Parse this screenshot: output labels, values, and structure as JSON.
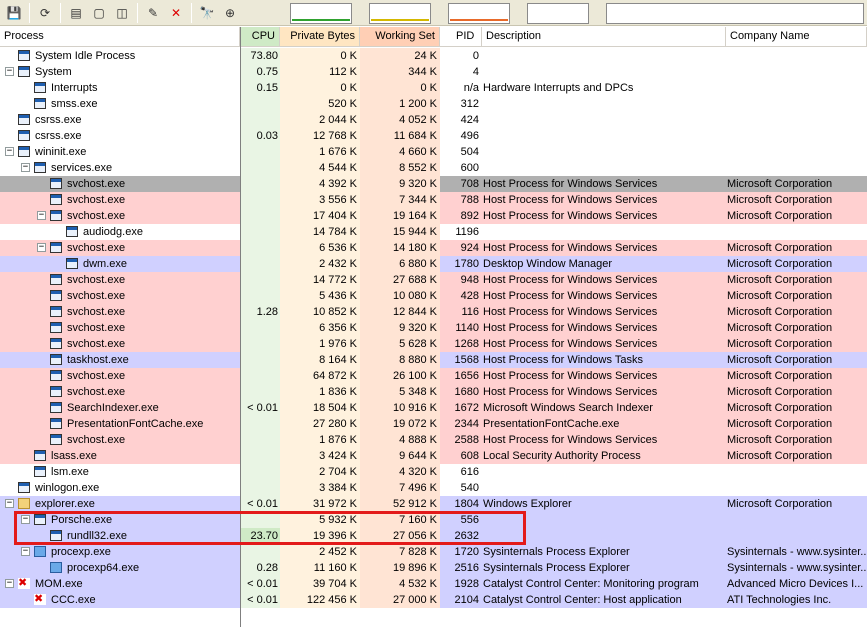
{
  "colors": {
    "service_bg": "#ffd0d0",
    "own_bg": "#d0d0ff",
    "selected_bg": "#b0b0b0",
    "cpu_col_bg": "#e9f5e4",
    "priv_col_bg": "#fff2de",
    "work_col_bg": "#ffe4d4",
    "highlight": "#e31a1a"
  },
  "toolbar": {
    "buttons": [
      "save-icon",
      "refresh-icon",
      "system-info-icon",
      "window-icon",
      "find-window-icon",
      "properties-icon",
      "kill-icon",
      "find-icon",
      "target-icon"
    ],
    "glyphs": [
      "💾",
      "⟳",
      "▤",
      "▢",
      "◫",
      "✎",
      "✕",
      "🔭",
      "⊕"
    ]
  },
  "header": {
    "process": "Process",
    "cpu": "CPU",
    "private_bytes": "Private Bytes",
    "working_set": "Working Set",
    "pid": "PID",
    "description": "Description",
    "company": "Company Name"
  },
  "processes": [
    {
      "name": "System Idle Process",
      "level": 0,
      "expander": "",
      "cpu": "73.80",
      "priv": "0 K",
      "work": "24 K",
      "pid": "0",
      "desc": "",
      "company": "",
      "bg": "none"
    },
    {
      "name": "System",
      "level": 0,
      "expander": "−",
      "cpu": "0.75",
      "priv": "112 K",
      "work": "344 K",
      "pid": "4",
      "desc": "",
      "company": "",
      "bg": "none"
    },
    {
      "name": "Interrupts",
      "level": 1,
      "expander": "",
      "cpu": "0.15",
      "priv": "0 K",
      "work": "0 K",
      "pid": "n/a",
      "desc": "Hardware Interrupts and DPCs",
      "company": "",
      "bg": "none"
    },
    {
      "name": "smss.exe",
      "level": 1,
      "expander": "",
      "cpu": "",
      "priv": "520 K",
      "work": "1 200 K",
      "pid": "312",
      "desc": "",
      "company": "",
      "bg": "none"
    },
    {
      "name": "csrss.exe",
      "level": 0,
      "expander": "",
      "cpu": "",
      "priv": "2 044 K",
      "work": "4 052 K",
      "pid": "424",
      "desc": "",
      "company": "",
      "bg": "none"
    },
    {
      "name": "csrss.exe",
      "level": 0,
      "expander": "",
      "cpu": "0.03",
      "priv": "12 768 K",
      "work": "11 684 K",
      "pid": "496",
      "desc": "",
      "company": "",
      "bg": "none"
    },
    {
      "name": "wininit.exe",
      "level": 0,
      "expander": "−",
      "cpu": "",
      "priv": "1 676 K",
      "work": "4 660 K",
      "pid": "504",
      "desc": "",
      "company": "",
      "bg": "none"
    },
    {
      "name": "services.exe",
      "level": 1,
      "expander": "−",
      "cpu": "",
      "priv": "4 544 K",
      "work": "8 552 K",
      "pid": "600",
      "desc": "",
      "company": "",
      "bg": "none"
    },
    {
      "name": "svchost.exe",
      "level": 2,
      "expander": "",
      "cpu": "",
      "priv": "4 392 K",
      "work": "9 320 K",
      "pid": "708",
      "desc": "Host Process for Windows Services",
      "company": "Microsoft Corporation",
      "bg": "selected"
    },
    {
      "name": "svchost.exe",
      "level": 2,
      "expander": "",
      "cpu": "",
      "priv": "3 556 K",
      "work": "7 344 K",
      "pid": "788",
      "desc": "Host Process for Windows Services",
      "company": "Microsoft Corporation",
      "bg": "service"
    },
    {
      "name": "svchost.exe",
      "level": 2,
      "expander": "−",
      "cpu": "",
      "priv": "17 404 K",
      "work": "19 164 K",
      "pid": "892",
      "desc": "Host Process for Windows Services",
      "company": "Microsoft Corporation",
      "bg": "service"
    },
    {
      "name": "audiodg.exe",
      "level": 3,
      "expander": "",
      "cpu": "",
      "priv": "14 784 K",
      "work": "15 944 K",
      "pid": "1196",
      "desc": "",
      "company": "",
      "bg": "none"
    },
    {
      "name": "svchost.exe",
      "level": 2,
      "expander": "−",
      "cpu": "",
      "priv": "6 536 K",
      "work": "14 180 K",
      "pid": "924",
      "desc": "Host Process for Windows Services",
      "company": "Microsoft Corporation",
      "bg": "service"
    },
    {
      "name": "dwm.exe",
      "level": 3,
      "expander": "",
      "cpu": "",
      "priv": "2 432 K",
      "work": "6 880 K",
      "pid": "1780",
      "desc": "Desktop Window Manager",
      "company": "Microsoft Corporation",
      "bg": "own"
    },
    {
      "name": "svchost.exe",
      "level": 2,
      "expander": "",
      "cpu": "",
      "priv": "14 772 K",
      "work": "27 688 K",
      "pid": "948",
      "desc": "Host Process for Windows Services",
      "company": "Microsoft Corporation",
      "bg": "service"
    },
    {
      "name": "svchost.exe",
      "level": 2,
      "expander": "",
      "cpu": "",
      "priv": "5 436 K",
      "work": "10 080 K",
      "pid": "428",
      "desc": "Host Process for Windows Services",
      "company": "Microsoft Corporation",
      "bg": "service"
    },
    {
      "name": "svchost.exe",
      "level": 2,
      "expander": "",
      "cpu": "1.28",
      "priv": "10 852 K",
      "work": "12 844 K",
      "pid": "116",
      "desc": "Host Process for Windows Services",
      "company": "Microsoft Corporation",
      "bg": "service"
    },
    {
      "name": "svchost.exe",
      "level": 2,
      "expander": "",
      "cpu": "",
      "priv": "6 356 K",
      "work": "9 320 K",
      "pid": "1140",
      "desc": "Host Process for Windows Services",
      "company": "Microsoft Corporation",
      "bg": "service"
    },
    {
      "name": "svchost.exe",
      "level": 2,
      "expander": "",
      "cpu": "",
      "priv": "1 976 K",
      "work": "5 628 K",
      "pid": "1268",
      "desc": "Host Process for Windows Services",
      "company": "Microsoft Corporation",
      "bg": "service"
    },
    {
      "name": "taskhost.exe",
      "level": 2,
      "expander": "",
      "cpu": "",
      "priv": "8 164 K",
      "work": "8 880 K",
      "pid": "1568",
      "desc": "Host Process for Windows Tasks",
      "company": "Microsoft Corporation",
      "bg": "own"
    },
    {
      "name": "svchost.exe",
      "level": 2,
      "expander": "",
      "cpu": "",
      "priv": "64 872 K",
      "work": "26 100 K",
      "pid": "1656",
      "desc": "Host Process for Windows Services",
      "company": "Microsoft Corporation",
      "bg": "service"
    },
    {
      "name": "svchost.exe",
      "level": 2,
      "expander": "",
      "cpu": "",
      "priv": "1 836 K",
      "work": "5 348 K",
      "pid": "1680",
      "desc": "Host Process for Windows Services",
      "company": "Microsoft Corporation",
      "bg": "service"
    },
    {
      "name": "SearchIndexer.exe",
      "level": 2,
      "expander": "",
      "cpu": "< 0.01",
      "priv": "18 504 K",
      "work": "10 916 K",
      "pid": "1672",
      "desc": "Microsoft Windows Search Indexer",
      "company": "Microsoft Corporation",
      "bg": "service"
    },
    {
      "name": "PresentationFontCache.exe",
      "level": 2,
      "expander": "",
      "cpu": "",
      "priv": "27 280 K",
      "work": "19 072 K",
      "pid": "2344",
      "desc": "PresentationFontCache.exe",
      "company": "Microsoft Corporation",
      "bg": "service"
    },
    {
      "name": "svchost.exe",
      "level": 2,
      "expander": "",
      "cpu": "",
      "priv": "1 876 K",
      "work": "4 888 K",
      "pid": "2588",
      "desc": "Host Process for Windows Services",
      "company": "Microsoft Corporation",
      "bg": "service"
    },
    {
      "name": "lsass.exe",
      "level": 1,
      "expander": "",
      "cpu": "",
      "priv": "3 424 K",
      "work": "9 644 K",
      "pid": "608",
      "desc": "Local Security Authority Process",
      "company": "Microsoft Corporation",
      "bg": "service"
    },
    {
      "name": "lsm.exe",
      "level": 1,
      "expander": "",
      "cpu": "",
      "priv": "2 704 K",
      "work": "4 320 K",
      "pid": "616",
      "desc": "",
      "company": "",
      "bg": "none"
    },
    {
      "name": "winlogon.exe",
      "level": 0,
      "expander": "",
      "cpu": "",
      "priv": "3 384 K",
      "work": "7 496 K",
      "pid": "540",
      "desc": "",
      "company": "",
      "bg": "none"
    },
    {
      "name": "explorer.exe",
      "level": 0,
      "expander": "−",
      "cpu": "< 0.01",
      "priv": "31 972 K",
      "work": "52 912 K",
      "pid": "1804",
      "desc": "Windows Explorer",
      "company": "Microsoft Corporation",
      "bg": "own",
      "icon": "folder"
    },
    {
      "name": "Porsche.exe",
      "level": 1,
      "expander": "−",
      "cpu": "",
      "priv": "5 932 K",
      "work": "7 160 K",
      "pid": "556",
      "desc": "",
      "company": "",
      "bg": "own"
    },
    {
      "name": "rundll32.exe",
      "level": 2,
      "expander": "",
      "cpu": "23.70",
      "priv": "19 396 K",
      "work": "27 056 K",
      "pid": "2632",
      "desc": "",
      "company": "",
      "bg": "own"
    },
    {
      "name": "procexp.exe",
      "level": 1,
      "expander": "−",
      "cpu": "",
      "priv": "2 452 K",
      "work": "7 828 K",
      "pid": "1720",
      "desc": "Sysinternals Process Explorer",
      "company": "Sysinternals - www.sysinter...",
      "bg": "own",
      "icon": "procexp"
    },
    {
      "name": "procexp64.exe",
      "level": 2,
      "expander": "",
      "cpu": "0.28",
      "priv": "11 160 K",
      "work": "19 896 K",
      "pid": "2516",
      "desc": "Sysinternals Process Explorer",
      "company": "Sysinternals - www.sysinter...",
      "bg": "own",
      "icon": "procexp"
    },
    {
      "name": "MOM.exe",
      "level": 0,
      "expander": "−",
      "cpu": "< 0.01",
      "priv": "39 704 K",
      "work": "4 532 K",
      "pid": "1928",
      "desc": "Catalyst Control Center: Monitoring program",
      "company": "Advanced Micro Devices I...",
      "bg": "own",
      "icon": "ati"
    },
    {
      "name": "CCC.exe",
      "level": 1,
      "expander": "",
      "cpu": "< 0.01",
      "priv": "122 456 K",
      "work": "27 000 K",
      "pid": "2104",
      "desc": "Catalyst Control Center: Host application",
      "company": "ATI Technologies Inc.",
      "bg": "own",
      "icon": "ati"
    }
  ]
}
